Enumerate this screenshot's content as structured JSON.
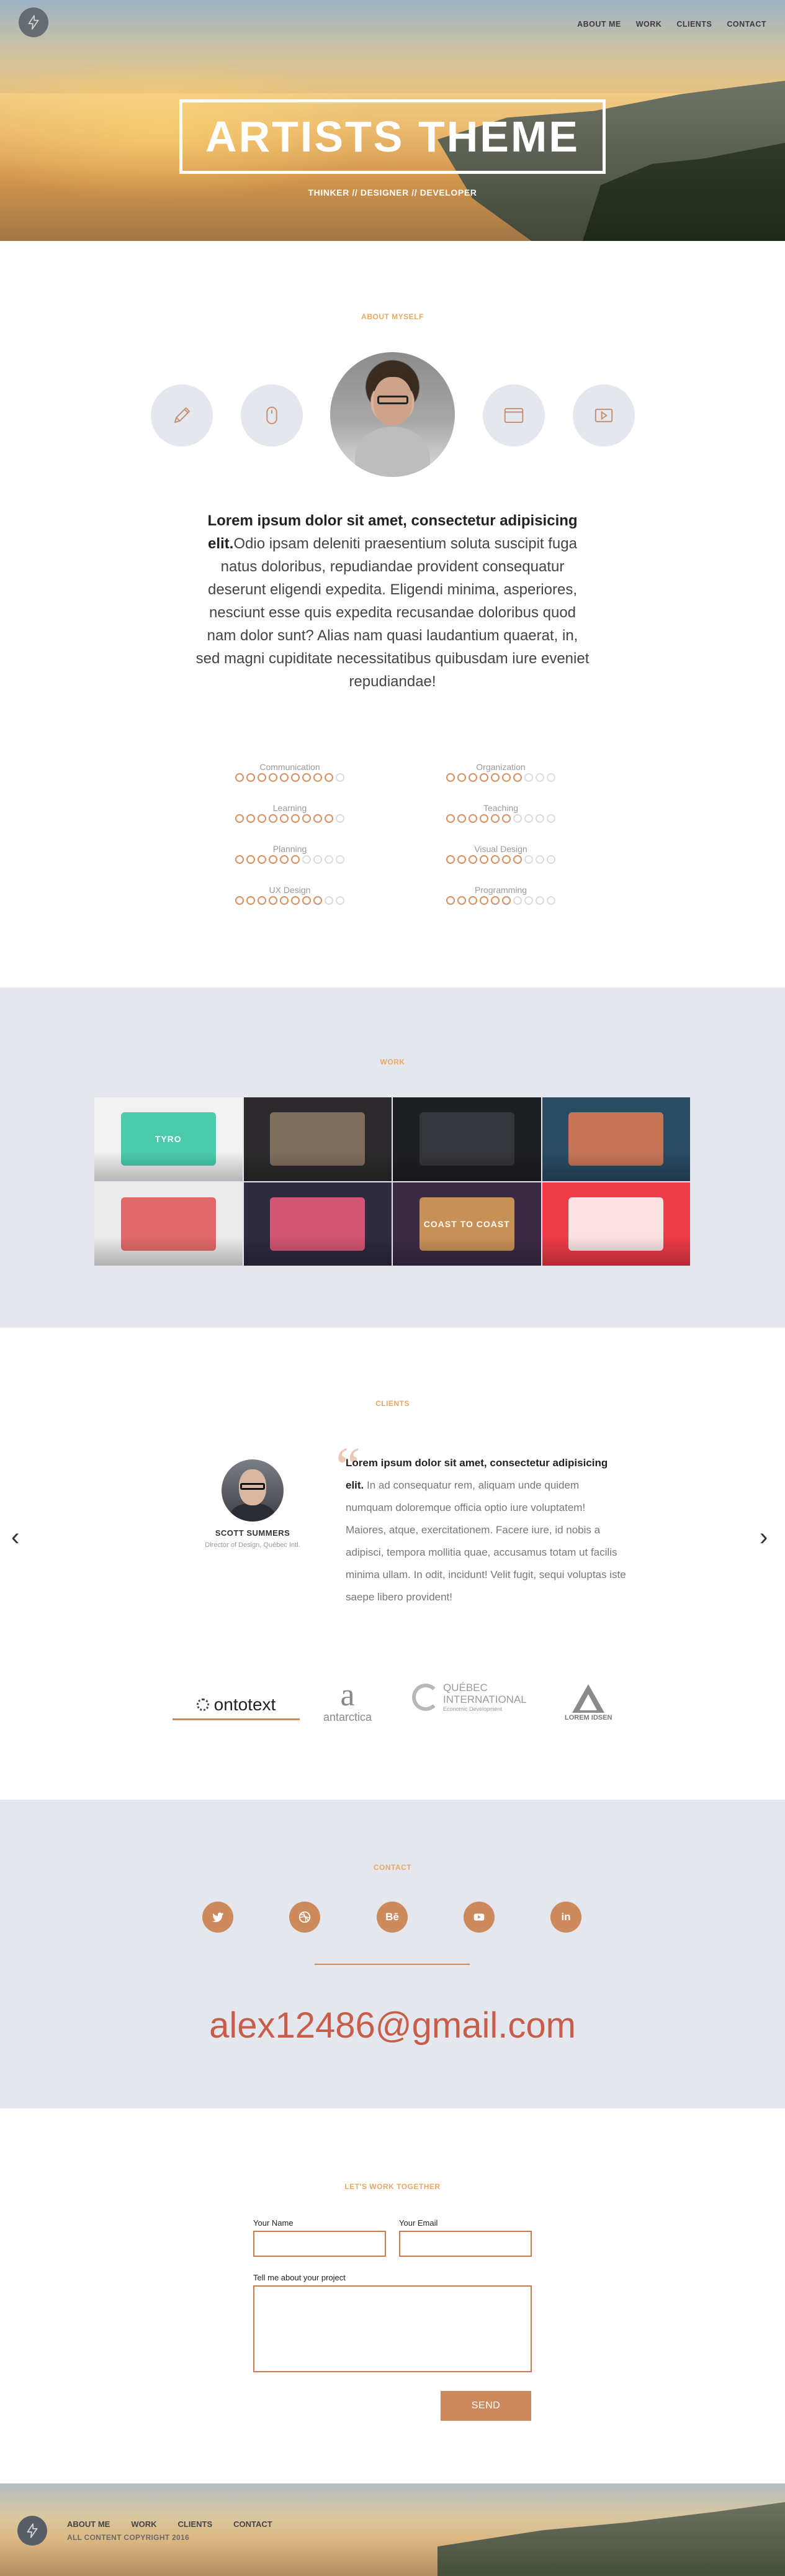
{
  "nav": {
    "items": [
      "ABOUT ME",
      "WORK",
      "CLIENTS",
      "CONTACT"
    ]
  },
  "hero": {
    "title": "ARTISTS THEME",
    "subtitle": "THINKER // DESIGNER // DEVELOPER"
  },
  "about": {
    "label": "ABOUT MYSELF",
    "icons": [
      "pencil-icon",
      "mouse-icon",
      "browser-window-icon",
      "video-play-icon"
    ],
    "intro_bold": "Lorem ipsum dolor sit amet, consectetur adipisicing elit.",
    "intro_text": "Odio ipsam deleniti praesentium soluta suscipit fuga natus doloribus, repudiandae provident consequatur deserunt eligendi expedita. Eligendi minima, asperiores, nesciunt esse quis expedita recusandae doloribus quod nam dolor sunt? Alias nam quasi laudantium quaerat, in, sed magni cupiditate necessitatibus quibusdam iure eveniet repudiandae!"
  },
  "skills": [
    {
      "name": "Communication",
      "level": 9,
      "max": 10
    },
    {
      "name": "Organization",
      "level": 7,
      "max": 10
    },
    {
      "name": "Learning",
      "level": 9,
      "max": 10
    },
    {
      "name": "Teaching",
      "level": 6,
      "max": 10
    },
    {
      "name": "Planning",
      "level": 6,
      "max": 10
    },
    {
      "name": "Visual Design",
      "level": 7,
      "max": 10
    },
    {
      "name": "UX Design",
      "level": 8,
      "max": 10
    },
    {
      "name": "Programming",
      "level": 6,
      "max": 10
    }
  ],
  "work": {
    "label": "WORK",
    "tiles": [
      {
        "name": "work-tile-tyro-app",
        "bg": "#f2f2f2",
        "accent": "#2ec4a0",
        "text": "TYRO"
      },
      {
        "name": "work-tile-dark-site",
        "bg": "#2c2a2c",
        "accent": "#8e7a66",
        "text": ""
      },
      {
        "name": "work-tile-keyboard",
        "bg": "#1e1f22",
        "accent": "#3a3b40",
        "text": ""
      },
      {
        "name": "work-tile-phone-ui",
        "bg": "#2a4b64",
        "accent": "#e37b55",
        "text": ""
      },
      {
        "name": "work-tile-red-charts",
        "bg": "#ececec",
        "accent": "#e05252",
        "text": ""
      },
      {
        "name": "work-tile-pink-app",
        "bg": "#2e2a40",
        "accent": "#ef5d7c",
        "text": ""
      },
      {
        "name": "work-tile-coast-poster",
        "bg": "#3a2b45",
        "accent": "#e0a25a",
        "text": "COAST TO COAST"
      },
      {
        "name": "work-tile-red-icons",
        "bg": "#ee3b48",
        "accent": "#ffffff",
        "text": ""
      }
    ]
  },
  "clients": {
    "label": "CLIENTS",
    "person_name": "SCOTT SUMMERS",
    "person_role": "Director of Design, Québec Intl.",
    "quote_bold": "Lorem ipsum dolor sit amet, consectetur adipisicing elit.",
    "quote_text": " In ad consequatur rem, aliquam unde quidem numquam doloremque officia optio iure voluptatem! Maiores, atque, exercitationem. Facere iure, id nobis a adipisci, tempora mollitia quae, accusamus totam ut facilis minima ullam. In odit, incidunt! Velit fugit, sequi voluptas iste saepe libero provident!",
    "logos": {
      "ontotext": "ontotext",
      "antarctica_letter": "a",
      "antarctica": "antarctica",
      "quebec_1": "QUÉBEC",
      "quebec_2": "INTERNATIONAL",
      "quebec_3": "Economic Development",
      "lorem": "LOREM IDSEN"
    }
  },
  "contact": {
    "label": "CONTACT",
    "social": [
      "twitter-icon",
      "dribbble-icon",
      "behance-icon",
      "youtube-icon",
      "linkedin-icon"
    ],
    "behance_text": "Bē",
    "linkedin_text": "in",
    "email": "alex12486@gmail.com"
  },
  "form": {
    "label": "LET'S WORK TOGETHER",
    "name_label": "Your Name",
    "email_label": "Your Email",
    "project_label": "Tell me about your project",
    "send": "SEND"
  },
  "footer": {
    "nav": [
      "ABOUT ME",
      "WORK",
      "CLIENTS",
      "CONTACT"
    ],
    "copyright": "ALL CONTENT COPYRIGHT 2016"
  },
  "colors": {
    "accent": "#cc8a5d",
    "label": "#e8a867",
    "panel": "#e4e8ee",
    "email": "#c85e4a"
  }
}
